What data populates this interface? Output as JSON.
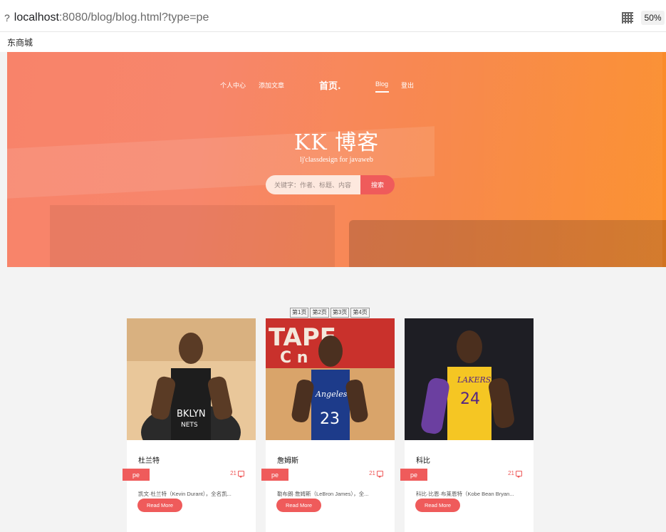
{
  "browser": {
    "url_prefix": "?",
    "url_host": "localhost",
    "url_rest": ":8080/blog/blog.html?type=pe",
    "zoom": "50%",
    "qr_icon": "qr-code-icon",
    "bookmark": "东商城"
  },
  "nav": {
    "items": [
      "个人中心",
      "添加文章"
    ],
    "brand": "首页.",
    "active": "Blog",
    "logout": "登出"
  },
  "hero": {
    "title": "KK 博客",
    "subtitle": "lj'classdesign for javaweb",
    "search_placeholder": "关键字：作者、标题、内容",
    "search_button": "搜索",
    "gradient_start": "#f8836a",
    "gradient_end": "#fb8b24"
  },
  "pagination": [
    "第1页",
    "第2页",
    "第3页",
    "第4页"
  ],
  "accent_color": "#ef5b5b",
  "cards": [
    {
      "name": "杜兰特",
      "tag": "pe",
      "comments": "21",
      "excerpt": "凯文·杜兰特（Kevin Durant），全名凯...",
      "button": "Read More"
    },
    {
      "name": "詹姆斯",
      "tag": "pe",
      "comments": "21",
      "excerpt": "勒布朗·詹姆斯（LeBron James），全...",
      "button": "Read More"
    },
    {
      "name": "科比",
      "tag": "pe",
      "comments": "21",
      "excerpt": "科比·比恩·布莱恩特（Kobe Bean Bryan...",
      "button": "Read More"
    }
  ]
}
